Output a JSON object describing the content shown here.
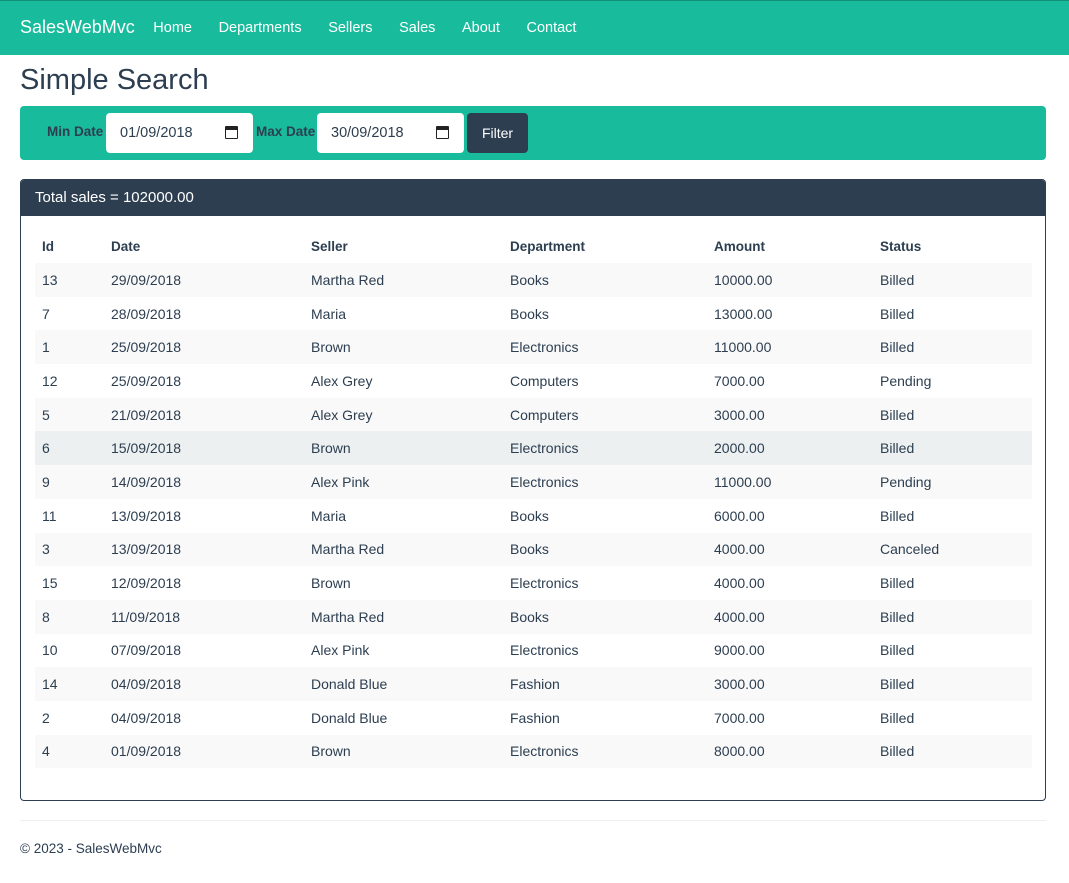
{
  "nav": {
    "brand": "SalesWebMvc",
    "links": [
      "Home",
      "Departments",
      "Sellers",
      "Sales",
      "About",
      "Contact"
    ]
  },
  "page": {
    "title": "Simple Search"
  },
  "filter": {
    "min_label": "Min Date",
    "min_value": "01/09/2018",
    "max_label": "Max Date",
    "max_value": "30/09/2018",
    "button_label": "Filter"
  },
  "panel": {
    "heading": "Total sales = 102000.00"
  },
  "table": {
    "headers": [
      "Id",
      "Date",
      "Seller",
      "Department",
      "Amount",
      "Status"
    ],
    "rows": [
      [
        "13",
        "29/09/2018",
        "Martha Red",
        "Books",
        "10000.00",
        "Billed"
      ],
      [
        "7",
        "28/09/2018",
        "Maria",
        "Books",
        "13000.00",
        "Billed"
      ],
      [
        "1",
        "25/09/2018",
        "Brown",
        "Electronics",
        "11000.00",
        "Billed"
      ],
      [
        "12",
        "25/09/2018",
        "Alex Grey",
        "Computers",
        "7000.00",
        "Pending"
      ],
      [
        "5",
        "21/09/2018",
        "Alex Grey",
        "Computers",
        "3000.00",
        "Billed"
      ],
      [
        "6",
        "15/09/2018",
        "Brown",
        "Electronics",
        "2000.00",
        "Billed"
      ],
      [
        "9",
        "14/09/2018",
        "Alex Pink",
        "Electronics",
        "11000.00",
        "Pending"
      ],
      [
        "11",
        "13/09/2018",
        "Maria",
        "Books",
        "6000.00",
        "Billed"
      ],
      [
        "3",
        "13/09/2018",
        "Martha Red",
        "Books",
        "4000.00",
        "Canceled"
      ],
      [
        "15",
        "12/09/2018",
        "Brown",
        "Electronics",
        "4000.00",
        "Billed"
      ],
      [
        "8",
        "11/09/2018",
        "Martha Red",
        "Books",
        "4000.00",
        "Billed"
      ],
      [
        "10",
        "07/09/2018",
        "Alex Pink",
        "Electronics",
        "9000.00",
        "Billed"
      ],
      [
        "14",
        "04/09/2018",
        "Donald Blue",
        "Fashion",
        "3000.00",
        "Billed"
      ],
      [
        "2",
        "04/09/2018",
        "Donald Blue",
        "Fashion",
        "7000.00",
        "Billed"
      ],
      [
        "4",
        "01/09/2018",
        "Brown",
        "Electronics",
        "8000.00",
        "Billed"
      ]
    ]
  },
  "footer": {
    "text": "© 2023 - SalesWebMvc"
  },
  "colors": {
    "primary": "#2c3e50",
    "accent": "#18bc9c",
    "row_stripe": "#f9f9f9",
    "row_hover": "#ecf0f1"
  },
  "icons": {
    "date_picker": "calendar-icon"
  }
}
